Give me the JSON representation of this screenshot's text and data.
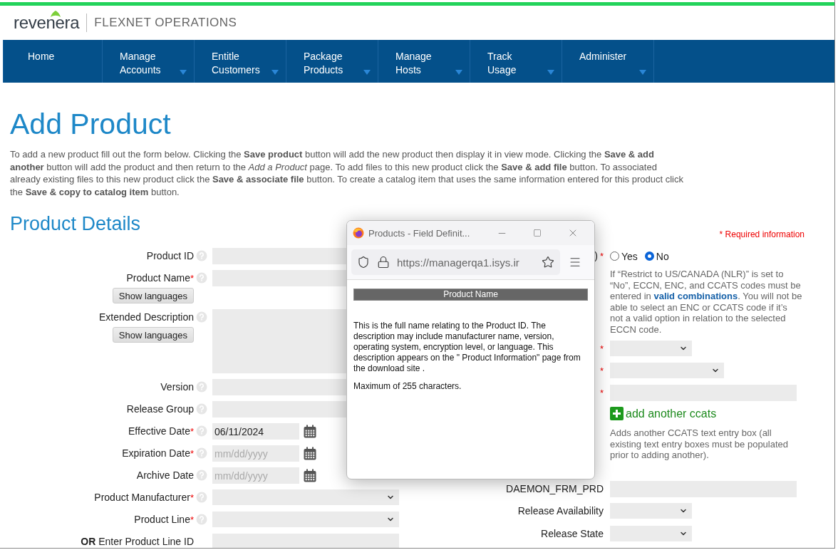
{
  "brand": {
    "logo": "revenera",
    "product": "FLEXNET OPERATIONS"
  },
  "nav": [
    {
      "label": "Home",
      "has_menu": false
    },
    {
      "label": "Manage Accounts",
      "has_menu": true
    },
    {
      "label": "Entitle Customers",
      "has_menu": true
    },
    {
      "label": "Package Products",
      "has_menu": true
    },
    {
      "label": "Manage Hosts",
      "has_menu": true
    },
    {
      "label": "Track Usage",
      "has_menu": true
    },
    {
      "label": "Administer",
      "has_menu": true
    }
  ],
  "title": "Add Product",
  "intro": "To add a new product fill out the form below. Clicking the **Save product** button will add the new product then display it in view mode. Clicking the **Save & add another** button will add the product and then return to the *Add a Product* page. To add files to this new product click the **Save & add file** button. To associated already existing files to this new product click the **Save & associate file** button. To create a catalog item that uses the same information entered for this product click the **Save & copy to catalog item** button.",
  "section_title": "Product Details",
  "required_note": {
    "mark": "*",
    "text": "Required information"
  },
  "left_fields": [
    {
      "kind": "text",
      "label": "Product ID",
      "required": false,
      "help": true
    },
    {
      "kind": "text",
      "label": "Product Name",
      "required": true,
      "help": true,
      "button": "Show languages"
    },
    {
      "kind": "textarea",
      "label": "Extended Description",
      "required": false,
      "help": true,
      "button": "Show languages"
    },
    {
      "kind": "text",
      "label": "Version",
      "required": false,
      "help": true
    },
    {
      "kind": "text",
      "label": "Release Group",
      "required": false,
      "help": true
    },
    {
      "kind": "date",
      "label": "Effective Date",
      "required": true,
      "help": true,
      "value": "06/11/2024"
    },
    {
      "kind": "date",
      "label": "Expiration Date",
      "required": true,
      "help": true,
      "placeholder": "mm/dd/yyyy"
    },
    {
      "kind": "date",
      "label": "Archive Date",
      "required": false,
      "help": true,
      "placeholder": "mm/dd/yyyy"
    },
    {
      "kind": "select",
      "label": "Product Manufacturer ",
      "required": true,
      "help": true
    },
    {
      "kind": "select",
      "label": "Product Line ",
      "required": true,
      "help": true
    },
    {
      "kind": "text",
      "label": "**OR** Enter Product Line ID",
      "required": false,
      "help": false
    }
  ],
  "right_fields": [
    {
      "kind": "radio",
      "label": ")",
      "required": true,
      "options": [
        {
          "label": "Yes",
          "selected": false
        },
        {
          "label": "No",
          "selected": true
        }
      ]
    },
    {
      "kind": "note",
      "before": "If “Restrict to US/CANADA (NLR)” is set to “No”, ECCN, ENC, and CCATS codes must be entered in ",
      "link": "valid combinations",
      "after": ". You will not be able to select an ENC or CCATS code if it’s not a valid option in relation to the selected ECCN code."
    },
    {
      "kind": "select",
      "required": true,
      "wide": false
    },
    {
      "kind": "select",
      "required": true,
      "wide": true
    },
    {
      "kind": "text",
      "required": true
    },
    {
      "kind": "add",
      "label": "add another ccats"
    },
    {
      "kind": "help",
      "text": "Adds another CCATS  text entry box (all existing text entry boxes must be populated prior to adding another)."
    },
    {
      "kind": "text",
      "label": "DAEMON_FRM_PRD",
      "required": false
    },
    {
      "kind": "select",
      "label": "Release Availability",
      "required": false,
      "wide": false
    },
    {
      "kind": "select",
      "label": "Release State",
      "required": false,
      "wide": false
    }
  ],
  "popup": {
    "title": "Products - Field Definit...",
    "url": "https://managerqa1.isys.ir",
    "heading": "Product Name",
    "paragraphs": [
      "This is the full name relating to the Product ID. The description may include manufacturer name, version, operating system, encryption level, or language. This description appears on the \" Product Information\" page from the download site .",
      "Maximum of 255 characters."
    ]
  }
}
